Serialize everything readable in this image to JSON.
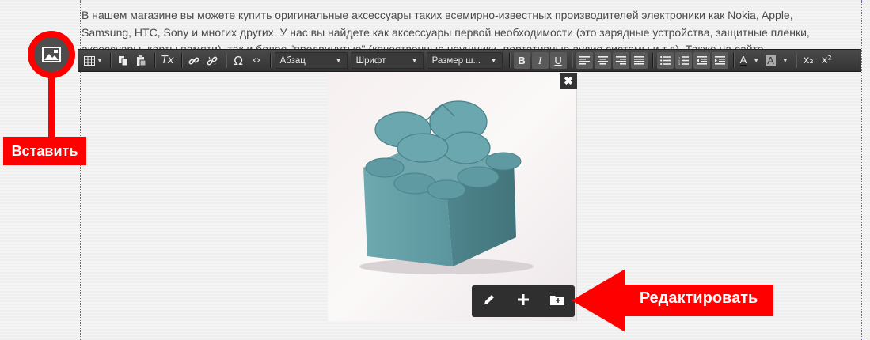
{
  "editor": {
    "paragraph_lines": [
      "В нашем магазине вы можете купить оригинальные аксессуары таких всемирно-известных производителей электроники как Nokia, Apple,",
      "Samsung, HTC, Sony и многих других. У нас вы найдете как аксессуары первой необходимости (это зарядные устройства, защитные пленки,",
      "аксессуары, карты памяти), так и более \"продвинутые\" (качественные наушники, портативные аудио системы и т.д). Также на сайте"
    ]
  },
  "toolbar": {
    "format_select": "Абзац",
    "font_select": "Шрифт",
    "size_select": "Размер ш...",
    "bold": "B",
    "italic": "I",
    "underline": "U",
    "text_color_label": "A",
    "bg_color_label": "A",
    "special_char": "Ω",
    "source": "‹›",
    "clear_format": "Tx",
    "subscript": "x₂",
    "superscript": "x²"
  },
  "callouts": {
    "insert_label": "Вставить",
    "edit_label": "Редактировать"
  },
  "colors": {
    "callout_red": "#ff0000",
    "toolbar_dark": "#333333",
    "box_teal": "#5a9aa4"
  },
  "icons": {
    "insert": "image-icon",
    "close": "close-icon",
    "edit": "pencil-icon",
    "add": "plus-icon",
    "folder": "folder-icon"
  }
}
